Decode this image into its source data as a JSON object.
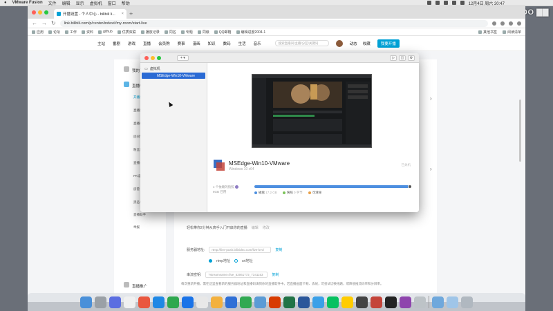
{
  "menubar": {
    "app": "VMware Fusion",
    "menus": [
      "文件",
      "编辑",
      "显示",
      "虚拟机",
      "窗口",
      "帮助"
    ],
    "datetime": "12月4日 周六  20:47"
  },
  "watermark": "OOOO",
  "browser": {
    "tab_title": "开播设置 - 个人中心 - bilibili li...",
    "new_tab": "+",
    "url": "link.bilibili.com/p/center/index#/my-room/start-live",
    "bookmarks": [
      "应用",
      "论坛",
      "工作",
      "资料",
      "github",
      "优质双联",
      "播放记录",
      "同名",
      "专题",
      "同级",
      "QQ邮箱",
      "编辑进度2004-1"
    ],
    "bookmarks_right": [
      "其他书签",
      "阅读清单"
    ]
  },
  "sitenav": {
    "links": [
      "主站",
      "番剧",
      "游戏",
      "直播",
      "会员购",
      "赛事",
      "漫画",
      "知识",
      "数码",
      "生活",
      "音乐"
    ],
    "search_placeholder": "搜索直播间/主播/分区/关键词",
    "user_links": [
      "动态",
      "收藏"
    ],
    "post_button": "我要开播"
  },
  "leftcol": {
    "section1": "我的直播间",
    "section2": "直播中心",
    "items": [
      "开播设置",
      "直播数据",
      "直播收益",
      "房间管理",
      "粉丝勋章",
      "直播公告",
      "PK设置",
      "房管",
      "黑名单",
      "直播助手",
      "举报"
    ],
    "bottom": "直播推广"
  },
  "maincol": {
    "address_label": "服务器地址:",
    "address_value": "rtmp://live-push.bilivideo.com/live-bvc/",
    "copy": "复制",
    "rtmp": "rtmp地址",
    "srt": "srt地址",
    "key_label": "串流密钥:",
    "key_value": "?streamname=live_52061772_7341153",
    "copy2": "复制",
    "topic": "轻松带你2分钟从高手入门开启你的直播",
    "tags": [
      "编辑",
      "修改"
    ],
    "note": "每次重新开播，需在这里查看新的服务器地址和直播码填到你的直播软件中。若直播画面卡顿、丢帧，可尝试切换线路，或降低推流码率和分辨率。"
  },
  "vmware": {
    "add_button": "+ ▾",
    "sidebar_header": "虚拟机",
    "selected_vm": "MSEdge-Win10-VMware",
    "vm_name": "MSEdge-Win10-VMware",
    "vm_os": "Windows 10 x64",
    "vm_note": "已关机",
    "snapshot_count": "4 个依赖的快照",
    "disk_size": "8GB 已用",
    "legend": [
      "磁盘",
      "快照",
      "可清除"
    ],
    "legend_values": [
      "17.2 GB",
      "0 字节",
      ""
    ],
    "disk_usage_fraction": 0.99,
    "colors": {
      "disk": "#4d8fe0",
      "snapshot": "#7cc35a",
      "reclaimable": "#e8a14a"
    }
  }
}
